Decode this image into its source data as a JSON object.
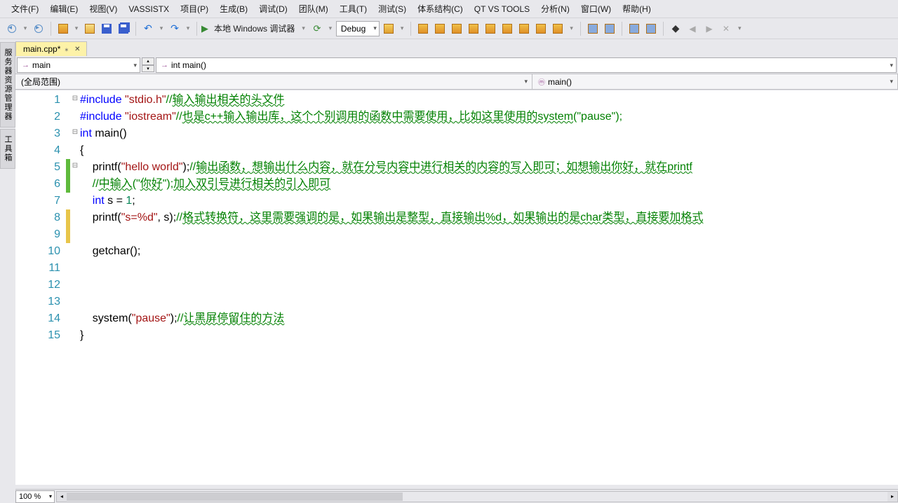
{
  "menu": {
    "items": [
      "文件(F)",
      "编辑(E)",
      "视图(V)",
      "VASSISTX",
      "项目(P)",
      "生成(B)",
      "调试(D)",
      "团队(M)",
      "工具(T)",
      "测试(S)",
      "体系结构(C)",
      "QT VS TOOLS",
      "分析(N)",
      "窗口(W)",
      "帮助(H)"
    ]
  },
  "toolbar": {
    "start_label": "本地 Windows 调试器",
    "config_label": "Debug"
  },
  "tabs": {
    "active": {
      "label": "main.cpp*",
      "modified": true
    }
  },
  "side_tabs": [
    "服务器资源管理器",
    "工具箱"
  ],
  "nav": {
    "project": "main",
    "symbol": "int main()"
  },
  "scope": {
    "left": "(全局范围)",
    "right": "main()"
  },
  "editor": {
    "line_numbers": [
      1,
      2,
      3,
      4,
      5,
      6,
      7,
      8,
      9,
      10,
      11,
      12,
      13,
      14,
      15
    ],
    "fold_markers": {
      "1": "⊟",
      "2": "",
      "3": "⊟",
      "4": "",
      "5": "⊟"
    },
    "change_markers": {
      "5": "green",
      "6": "green",
      "8": "yellow",
      "9": "yellow"
    },
    "code_tokens": [
      [
        [
          "kw",
          "#include "
        ],
        [
          "str",
          "\"stdio.h\""
        ],
        [
          "cmt",
          "//"
        ],
        [
          "cmt-wavy",
          "输入输出相关的头文件"
        ]
      ],
      [
        [
          "kw",
          "#include "
        ],
        [
          "str",
          "\"iostream\""
        ],
        [
          "cmt",
          "//"
        ],
        [
          "cmt-wavy",
          "也是c++输入输出库，这个个别调用的函数中需要使用，比如这里使用的system"
        ],
        [
          "cmt",
          "(\"pause\");"
        ]
      ],
      [
        [
          "kw",
          "int"
        ],
        [
          "ident",
          " main()"
        ]
      ],
      [
        [
          "ident",
          "{"
        ]
      ],
      [
        [
          "ident",
          "    "
        ],
        [
          "fn",
          "printf"
        ],
        [
          "ident",
          "("
        ],
        [
          "str",
          "\"hello world\""
        ],
        [
          "ident",
          ");"
        ],
        [
          "cmt",
          "//"
        ],
        [
          "cmt-wavy",
          "输出函数，想输出什么内容，就在分号内容中进行相关的内容的写入即可；如想输出你好，就在printf"
        ]
      ],
      [
        [
          "ident",
          "    "
        ],
        [
          "cmt",
          "//"
        ],
        [
          "cmt-wavy",
          "中输入"
        ],
        [
          "cmt",
          "(\""
        ],
        [
          "cmt-wavy",
          "你好"
        ],
        [
          "cmt",
          "\");"
        ],
        [
          "cmt-wavy",
          "加入双引号进行相关的引入即可"
        ]
      ],
      [
        [
          "ident",
          "    "
        ],
        [
          "kw",
          "int"
        ],
        [
          "ident",
          " s = "
        ],
        [
          "num",
          "1"
        ],
        [
          "ident",
          ";"
        ]
      ],
      [
        [
          "ident",
          "    "
        ],
        [
          "fn",
          "printf"
        ],
        [
          "ident",
          "("
        ],
        [
          "str",
          "\"s=%d\""
        ],
        [
          "ident",
          ", s);"
        ],
        [
          "cmt",
          "//"
        ],
        [
          "cmt-wavy",
          "格式转换符，这里需要强调的是，如果输出是整型，直接输出%d，如果输出的是char类型，直接要加格式"
        ]
      ],
      [
        [
          "ident",
          ""
        ]
      ],
      [
        [
          "ident",
          "    "
        ],
        [
          "fn",
          "getchar"
        ],
        [
          "ident",
          "();"
        ]
      ],
      [
        [
          "ident",
          ""
        ]
      ],
      [
        [
          "ident",
          ""
        ]
      ],
      [
        [
          "ident",
          ""
        ]
      ],
      [
        [
          "ident",
          "    "
        ],
        [
          "fn",
          "system"
        ],
        [
          "ident",
          "("
        ],
        [
          "str",
          "\"pause\""
        ],
        [
          "ident",
          ");"
        ],
        [
          "cmt",
          "//"
        ],
        [
          "cmt-wavy",
          "让黑屏停留住的方法"
        ]
      ],
      [
        [
          "ident",
          "}"
        ]
      ]
    ]
  },
  "zoom": "100 %"
}
